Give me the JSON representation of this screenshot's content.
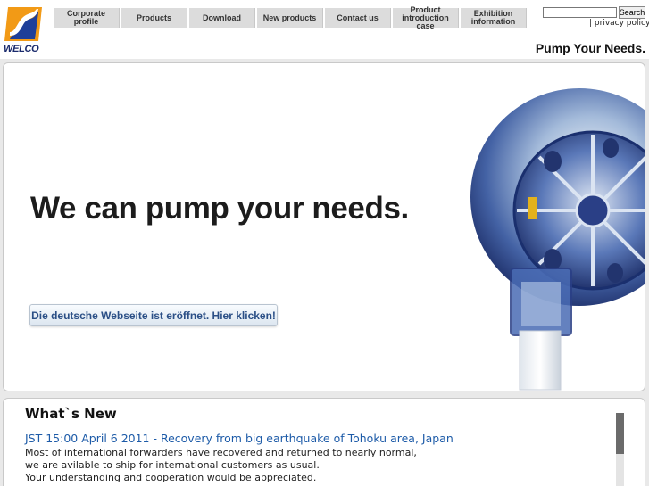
{
  "brand": {
    "logo_text": "WELCO",
    "tagline": "Pump Your Needs."
  },
  "nav": {
    "items": [
      {
        "label": "Corporate profile"
      },
      {
        "label": "Products"
      },
      {
        "label": "Download"
      },
      {
        "label": "New products"
      },
      {
        "label": "Contact us"
      },
      {
        "label": "Product introduction case"
      },
      {
        "label": "Exhibition information"
      }
    ]
  },
  "search": {
    "value": "",
    "button_label": "Search"
  },
  "utility": {
    "privacy_prefix": "| ",
    "privacy_label": "privacy policy",
    "privacy_suffix": " |"
  },
  "hero": {
    "headline": "We can pump your needs.",
    "german_link": "Die deutsche Webseite ist eröffnet. Hier klicken!"
  },
  "news": {
    "title": "What`s New",
    "headline_link": "JST 15:00 April 6 2011 - Recovery from big earthquake of Tohoku area, Japan",
    "lines": [
      "Most of international forwarders have recovered and returned to nearly normal,",
      "we are avilable to ship for international customers as usual.",
      "Your understanding and cooperation would be appreciated."
    ]
  },
  "colors": {
    "logo_orange": "#f29a16",
    "logo_blue": "#1f3f99",
    "link_blue": "#1d5ba8",
    "nav_gray": "#dcdcdc"
  }
}
